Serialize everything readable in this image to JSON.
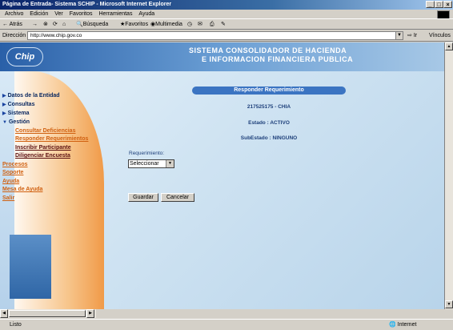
{
  "window": {
    "title": "Página de Entrada- Sistema SCHIP - Microsoft Internet Explorer"
  },
  "menu": [
    "Archivo",
    "Edición",
    "Ver",
    "Favoritos",
    "Herramientas",
    "Ayuda"
  ],
  "toolbar": {
    "back": "Atrás",
    "search": "Búsqueda",
    "favorites": "Favoritos",
    "multimedia": "Multimedia"
  },
  "address": {
    "label": "Dirección",
    "url": "http://www.chip.gov.co",
    "go": "Ir",
    "links": "Vínculos"
  },
  "header": {
    "logo": "Chip",
    "line1": "SISTEMA CONSOLIDADOR DE HACIENDA",
    "line2": "E INFORMACION FINANCIERA PUBLICA"
  },
  "sidebar": {
    "items": [
      "Datos de la Entidad",
      "Consultas",
      "Sistema",
      "Gestión"
    ],
    "sub_items": [
      "Consultar Deficiencias",
      "Responder Requerimientos",
      "Inscribir Participante",
      "Diligenciar Encuesta"
    ],
    "categories": [
      "Procesos",
      "Soporte",
      "Ayuda",
      "Mesa de Ayuda",
      "Salir"
    ]
  },
  "panel": {
    "header": "Responder Requerimiento",
    "entity": "217525175 - CHIA",
    "estado": "Estado : ACTIVO",
    "subestado": "SubEstado : NINGUNO",
    "req_label": "Requerimiento:",
    "select_value": "Seleccionar",
    "save": "Guardar",
    "cancel": "Cancelar"
  },
  "status": {
    "text": "Listo",
    "zone": "Internet"
  }
}
